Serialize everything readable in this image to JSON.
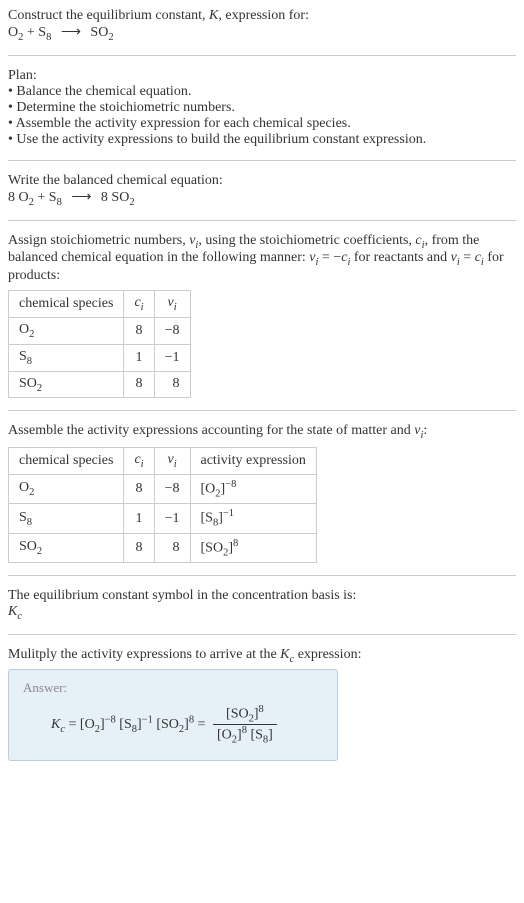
{
  "intro": {
    "line1": "Construct the equilibrium constant, ",
    "Ksym": "K",
    "line1b": ", expression for:",
    "eq_lhs1": "O",
    "eq_lhs1_sub": "2",
    "plus": " + ",
    "eq_lhs2": "S",
    "eq_lhs2_sub": "8",
    "arrow": "⟶",
    "eq_rhs": "SO",
    "eq_rhs_sub": "2"
  },
  "plan": {
    "title": "Plan:",
    "items": [
      "• Balance the chemical equation.",
      "• Determine the stoichiometric numbers.",
      "• Assemble the activity expression for each chemical species.",
      "• Use the activity expressions to build the equilibrium constant expression."
    ]
  },
  "balanced": {
    "intro": "Write the balanced chemical equation:",
    "c1": "8 ",
    "sp1": "O",
    "sp1s": "2",
    "plus": " + ",
    "sp2": "S",
    "sp2s": "8",
    "arrow": "⟶",
    "c2": "8 ",
    "sp3": "SO",
    "sp3s": "2"
  },
  "assign": {
    "text1": "Assign stoichiometric numbers, ",
    "nu": "ν",
    "nusub": "i",
    "text2": ", using the stoichiometric coefficients, ",
    "c": "c",
    "csub": "i",
    "text3": ", from the balanced chemical equation in the following manner: ",
    "rel1a": "ν",
    "rel1b": "i",
    "rel1c": " = −",
    "rel1d": "c",
    "rel1e": "i",
    "text4": " for reactants and ",
    "rel2a": "ν",
    "rel2b": "i",
    "rel2c": " = ",
    "rel2d": "c",
    "rel2e": "i",
    "text5": " for products:"
  },
  "table1": {
    "h1": "chemical species",
    "h2c": "c",
    "h2s": "i",
    "h3c": "ν",
    "h3s": "i",
    "rows": [
      {
        "sp": "O",
        "sps": "2",
        "c": "8",
        "nu": "−8"
      },
      {
        "sp": "S",
        "sps": "8",
        "c": "1",
        "nu": "−1"
      },
      {
        "sp": "SO",
        "sps": "2",
        "c": "8",
        "nu": "8"
      }
    ]
  },
  "assemble": {
    "text1": "Assemble the activity expressions accounting for the state of matter and ",
    "nu": "ν",
    "nus": "i",
    "text2": ":"
  },
  "table2": {
    "h1": "chemical species",
    "h2c": "c",
    "h2s": "i",
    "h3c": "ν",
    "h3s": "i",
    "h4": "activity expression",
    "rows": [
      {
        "sp": "O",
        "sps": "2",
        "c": "8",
        "nu": "−8",
        "ae_base": "[O",
        "ae_sub": "2",
        "ae_close": "]",
        "ae_exp": "−8"
      },
      {
        "sp": "S",
        "sps": "8",
        "c": "1",
        "nu": "−1",
        "ae_base": "[S",
        "ae_sub": "8",
        "ae_close": "]",
        "ae_exp": "−1"
      },
      {
        "sp": "SO",
        "sps": "2",
        "c": "8",
        "nu": "8",
        "ae_base": "[SO",
        "ae_sub": "2",
        "ae_close": "]",
        "ae_exp": "8"
      }
    ]
  },
  "basis": {
    "text": "The equilibrium constant symbol in the concentration basis is:",
    "K": "K",
    "Ks": "c"
  },
  "multiply": {
    "text1": "Mulitply the activity expressions to arrive at the ",
    "K": "K",
    "Ks": "c",
    "text2": " expression:"
  },
  "answer": {
    "label": "Answer:",
    "K": "K",
    "Ks": "c",
    "eq": " = ",
    "t1a": "[O",
    "t1s": "2",
    "t1c": "]",
    "t1e": "−8",
    "t2a": "[S",
    "t2s": "8",
    "t2c": "]",
    "t2e": "−1",
    "t3a": "[SO",
    "t3s": "2",
    "t3c": "]",
    "t3e": "8",
    "eq2": " = ",
    "num_a": "[SO",
    "num_s": "2",
    "num_c": "]",
    "num_e": "8",
    "den1_a": "[O",
    "den1_s": "2",
    "den1_c": "]",
    "den1_e": "8",
    "den2_a": "[S",
    "den2_s": "8",
    "den2_c": "]"
  }
}
